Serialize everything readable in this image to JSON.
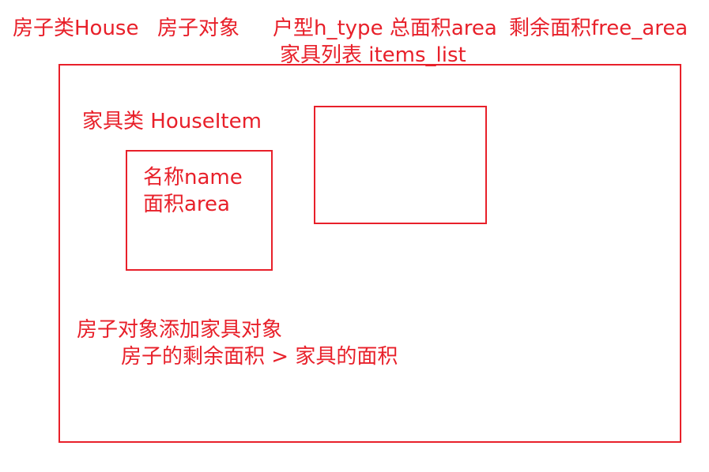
{
  "header": {
    "house_class": "房子类House",
    "house_object": "房子对象",
    "h_type": "户型h_type 总面积area",
    "free_area": "剩余面积free_area",
    "items_list": "家具列表  items_list"
  },
  "item_class": {
    "label": "家具类 HouseItem",
    "name_attr": "名称name",
    "area_attr": "面积area"
  },
  "notes": {
    "add_item": "房子对象添加家具对象",
    "condition": "房子的剩余面积 > 家具的面积"
  },
  "colors": {
    "ink": "#e8202a",
    "background": "#ffffff"
  }
}
